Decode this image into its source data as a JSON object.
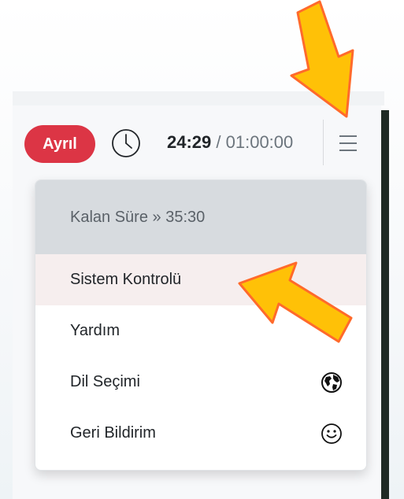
{
  "header": {
    "leave_label": "Ayrıl",
    "elapsed": "24:29",
    "separator": " / ",
    "total": "01:00:00"
  },
  "menu": {
    "remaining": "Kalan Süre » 35:30",
    "items": [
      {
        "label": "Sistem Kontrolü",
        "icon": ""
      },
      {
        "label": "Yardım",
        "icon": ""
      },
      {
        "label": "Dil Seçimi",
        "icon": "globe-icon"
      },
      {
        "label": "Geri Bildirim",
        "icon": "smiley-icon"
      }
    ]
  },
  "colors": {
    "leave": "#dc3545",
    "arrow_fill": "#ffc107",
    "arrow_stroke": "#ff6a2b"
  }
}
